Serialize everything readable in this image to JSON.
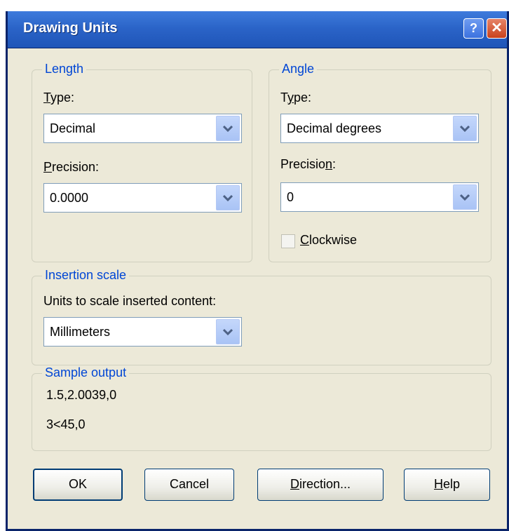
{
  "window": {
    "title": "Drawing Units",
    "help_glyph": "?",
    "close_glyph": "✕"
  },
  "length": {
    "legend": "Length",
    "type_label_first": "T",
    "type_label_rest": "ype:",
    "type_value": "Decimal",
    "precision_label_first": "P",
    "precision_label_rest": "recision:",
    "precision_value": "0.0000"
  },
  "angle": {
    "legend": "Angle",
    "type_label_first": "T",
    "type_label_underlined": "y",
    "type_label_rest": "pe:",
    "type_value": "Decimal degrees",
    "precision_label_first": "Precisio",
    "precision_label_underlined": "n",
    "precision_label_rest": ":",
    "precision_value": "0",
    "clockwise_first": "C",
    "clockwise_rest": "lockwise",
    "clockwise_checked": false
  },
  "insertion": {
    "legend": "Insertion scale",
    "label": "Units to scale inserted content:",
    "value": "Millimeters"
  },
  "sample": {
    "legend": "Sample output",
    "line1": "1.5,2.0039,0",
    "line2": "3<45,0"
  },
  "buttons": {
    "ok": "OK",
    "cancel": "Cancel",
    "direction_first": "D",
    "direction_rest": "irection...",
    "help_first": "H",
    "help_rest": "elp"
  },
  "colors": {
    "accent": "#0046d5",
    "titlebar": "#2b64c8",
    "dialog_bg": "#ece9d8"
  }
}
